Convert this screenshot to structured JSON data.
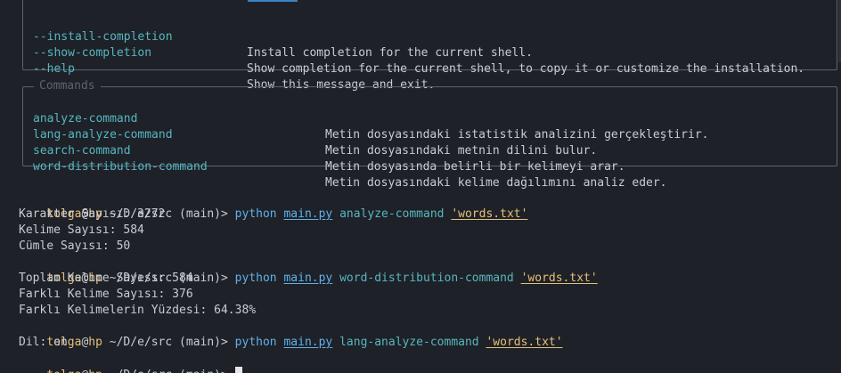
{
  "help_options": [
    {
      "name": "--install-completion",
      "desc": "Install completion for the current shell."
    },
    {
      "name": "--show-completion",
      "desc": "Show completion for the current shell, to copy it or customize the installation."
    },
    {
      "name": "--help",
      "desc": "Show this message and exit."
    }
  ],
  "commands_panel": {
    "title": "Commands",
    "items": [
      {
        "name": "analyze-command",
        "desc": "Metin dosyasındaki istatistik analizini gerçekleştirir."
      },
      {
        "name": "lang-analyze-command",
        "desc": "Metin dosyasındaki metnin dilini bulur."
      },
      {
        "name": "search-command",
        "desc": "Metin dosyasında belirli bir kelimeyi arar."
      },
      {
        "name": "word-distribution-command",
        "desc": "Metin dosyasındaki kelime dağılımını analiz eder."
      }
    ]
  },
  "prompt": {
    "user": "tolga",
    "at": "@",
    "host": "hp",
    "path": " ~/D/e/src",
    "branch": " (main)",
    "symbol": "> "
  },
  "session": [
    {
      "command": {
        "program": "python",
        "script": "main.py",
        "subcommand": "analyze-command",
        "argument": "'words.txt'"
      },
      "output": [
        "Karakter Sayısı: 3272",
        "Kelime Sayısı: 584",
        "Cümle Sayısı: 50"
      ]
    },
    {
      "command": {
        "program": "python",
        "script": "main.py",
        "subcommand": "word-distribution-command",
        "argument": "'words.txt'"
      },
      "output": [
        "Toplam Kelime Sayısı: 584",
        "Farklı Kelime Sayısı: 376",
        "Farklı Kelimelerin Yüzdesi: 64.38%"
      ]
    },
    {
      "command": {
        "program": "python",
        "script": "main.py",
        "subcommand": "lang-analyze-command",
        "argument": "'words.txt'"
      },
      "output": [
        "Dil: en"
      ]
    }
  ]
}
